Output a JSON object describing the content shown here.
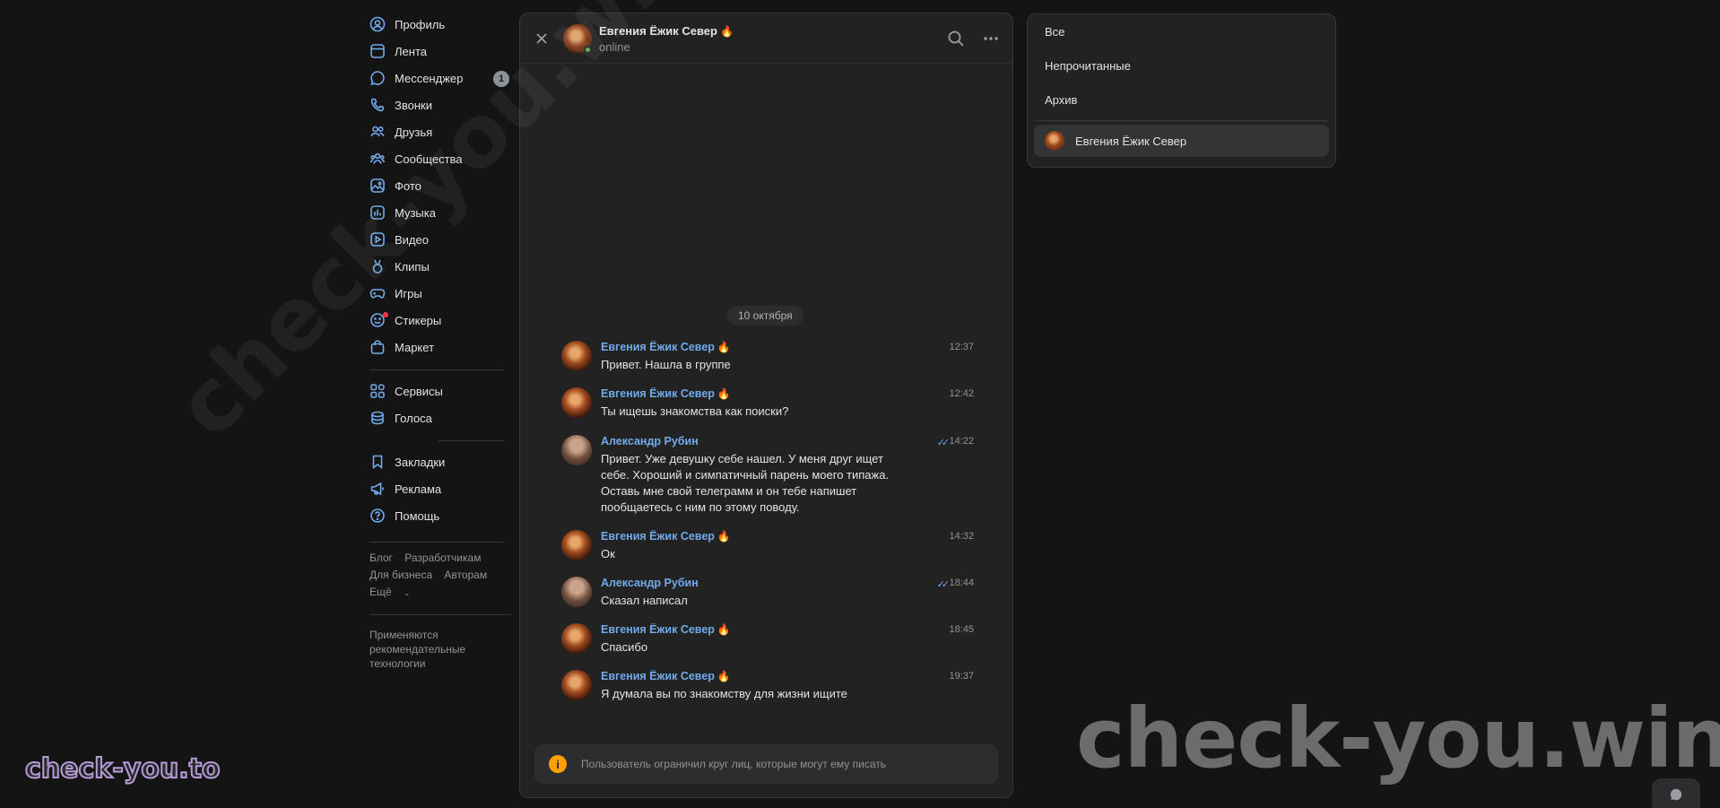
{
  "nav": {
    "items": [
      {
        "label": "Профиль",
        "icon": "profile-icon"
      },
      {
        "label": "Лента",
        "icon": "feed-icon"
      },
      {
        "label": "Мессенджер",
        "icon": "messenger-icon",
        "badge": "1"
      },
      {
        "label": "Звонки",
        "icon": "phone-icon"
      },
      {
        "label": "Друзья",
        "icon": "friends-icon"
      },
      {
        "label": "Сообщества",
        "icon": "communities-icon"
      },
      {
        "label": "Фото",
        "icon": "photo-icon"
      },
      {
        "label": "Музыка",
        "icon": "music-icon"
      },
      {
        "label": "Видео",
        "icon": "video-icon"
      },
      {
        "label": "Клипы",
        "icon": "clips-icon"
      },
      {
        "label": "Игры",
        "icon": "gamepad-icon"
      },
      {
        "label": "Стикеры",
        "icon": "sticker-icon"
      },
      {
        "label": "Маркет",
        "icon": "market-bag-icon"
      },
      {
        "label": "Сервисы",
        "icon": "services-grid-icon"
      },
      {
        "label": "Голоса",
        "icon": "coins-icon"
      },
      {
        "label": "Закладки",
        "icon": "bookmark-icon"
      },
      {
        "label": "Реклама",
        "icon": "megaphone-icon"
      },
      {
        "label": "Помощь",
        "icon": "help-icon"
      }
    ],
    "footer_links": [
      "Блог",
      "Разработчикам",
      "Для бизнеса",
      "Авторам",
      "Ещё"
    ],
    "footer_note": "Применяются рекомендательные технологии"
  },
  "chat": {
    "contact_name": "Евгения Ёжик Север",
    "contact_status": "online",
    "date_divider": "10 октября",
    "messages": [
      {
        "author": "Евгения Ёжик Север",
        "time": "12:37",
        "text": "Привет. Нашла в группе",
        "flame": true
      },
      {
        "author": "Евгения Ёжик Север",
        "time": "12:42",
        "text": "Ты ищешь знакомства как поиски?",
        "flame": true
      },
      {
        "author": "Александр Рубин",
        "time": "14:22",
        "text": "Привет. Уже девушку себе нашел. У меня друг ищет себе. Хороший и симпатичный парень моего типажа. Оставь мне свой телеграмм и он тебе напишет пообщаетесь с ним по этому поводу.",
        "read": true
      },
      {
        "author": "Евгения Ёжик Север",
        "time": "14:32",
        "text": "Ок",
        "flame": true
      },
      {
        "author": "Александр Рубин",
        "time": "18:44",
        "text": "Сказал написал",
        "read": true
      },
      {
        "author": "Евгения Ёжик Север",
        "time": "18:45",
        "text": "Спасибо",
        "flame": true
      },
      {
        "author": "Евгения Ёжик Север",
        "time": "19:37",
        "text": "Я думала вы по знакомству для жизни ищите",
        "flame": true
      }
    ],
    "restriction_notice": "Пользователь ограничил круг лиц, которые могут ему писать"
  },
  "filters": {
    "items": [
      "Все",
      "Непрочитанные",
      "Архив"
    ],
    "active_chat": "Евгения Ёжик Север"
  },
  "watermarks": {
    "diagonal": "check-you.win",
    "bottom_right": "check-you.win",
    "bottom_left": "check-you.to"
  },
  "colors": {
    "accent": "#71aaeb",
    "online": "#4bb34b",
    "warning": "#ffa000"
  }
}
